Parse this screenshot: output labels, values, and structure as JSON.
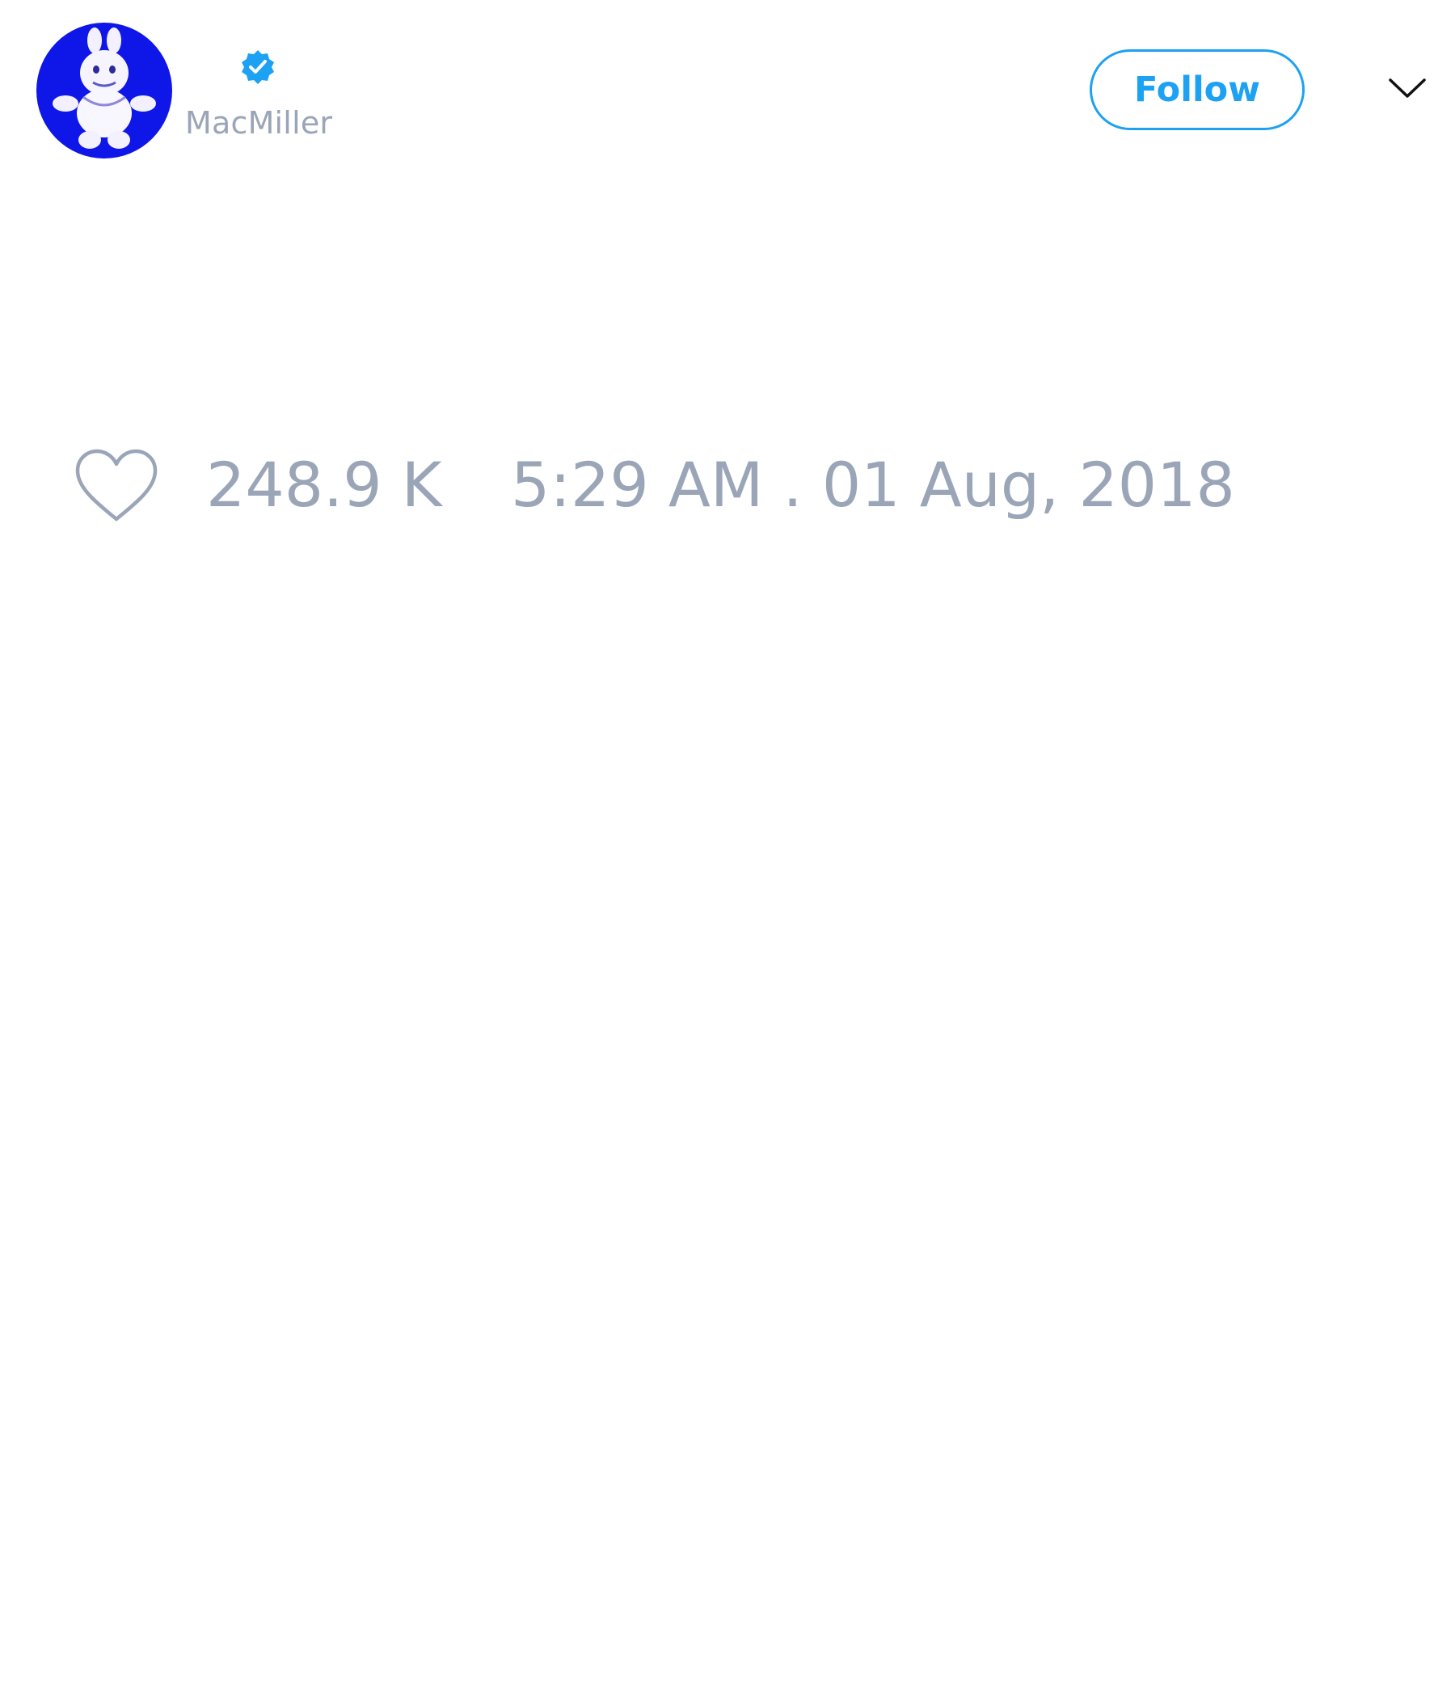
{
  "author": {
    "handle": "MacMiller",
    "verified": true,
    "avatar_icon": "bunny-character-avatar",
    "avatar_bg": "#0f16e8"
  },
  "actions": {
    "follow_label": "Follow",
    "menu_icon": "chevron-down-icon"
  },
  "stats": {
    "like_icon": "heart-outline-icon",
    "likes": "248.9 K",
    "timestamp": "5:29 AM . 01 Aug, 2018"
  },
  "colors": {
    "accent": "#1da1f2",
    "muted_text": "#9aa5b8",
    "background": "#ffffff"
  }
}
